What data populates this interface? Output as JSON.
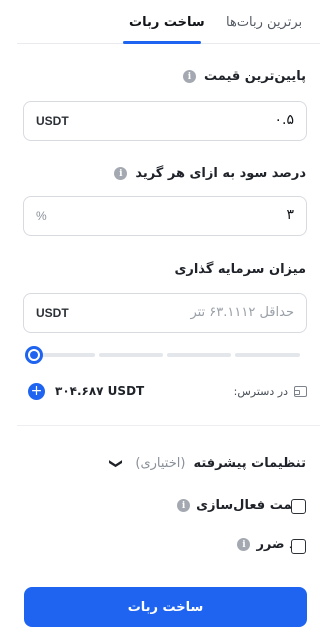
{
  "tabs": {
    "builder": "ساخت ربات",
    "top_bots": "برترین ربات‌ها"
  },
  "lowest_price": {
    "label": "پایین‌ترین قیمت",
    "unit": "USDT",
    "value": "۰.۵"
  },
  "profit_per_grid": {
    "label": "درصد سود به ازای هر گرید",
    "unit": "%",
    "value": "۳"
  },
  "investment": {
    "label": "میزان سرمایه گذاری",
    "unit": "USDT",
    "placeholder": "حداقل ۶۳.۱۱۱۲ تتر"
  },
  "slider": {
    "value_percent": 0
  },
  "available": {
    "label": "در دسترس:",
    "amount": "۳۰۴.۶۸۷ USDT",
    "add_symbol": "+"
  },
  "advanced": {
    "title": "تنظیمات پیشرفته",
    "optional": "(اختیاری)"
  },
  "options": {
    "activation_price": "قیمت فعال‌سازی",
    "stop_loss": "حد ضرر"
  },
  "submit": {
    "label": "ساخت ربات"
  },
  "colors": {
    "accent": "#1f64f0",
    "border": "#d7dadf",
    "info_icon": "#a4a9b1"
  }
}
